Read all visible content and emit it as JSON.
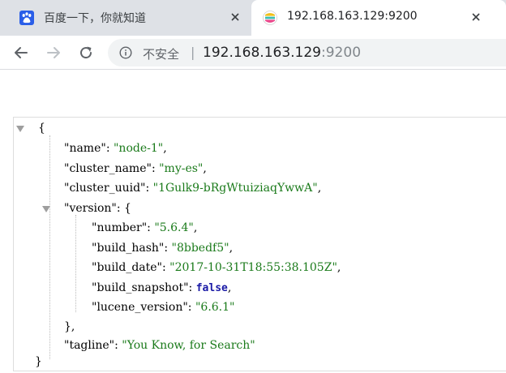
{
  "browser": {
    "tabs": [
      {
        "title": "百度一下，你就知道",
        "favicon": "baidu-paw-icon",
        "active": false
      },
      {
        "title": "192.168.163.129:9200",
        "favicon": "elastic-icon",
        "active": true
      }
    ],
    "toolbar": {
      "security_label": "不安全",
      "separator": "|",
      "url_host": "192.168.163.129",
      "url_port": ":9200"
    }
  },
  "json_viewer": {
    "open_brace": "{",
    "close_brace": "}",
    "fields": [
      {
        "key": "\"name\"",
        "sep": ": ",
        "value": "\"node-1\"",
        "tail": ","
      },
      {
        "key": "\"cluster_name\"",
        "sep": ": ",
        "value": "\"my-es\"",
        "tail": ","
      },
      {
        "key": "\"cluster_uuid\"",
        "sep": ": ",
        "value": "\"1Gulk9-bRgWtuiziaqYwwA\"",
        "tail": ","
      }
    ],
    "version": {
      "key": "\"version\"",
      "open": ": {",
      "close": "},",
      "fields": [
        {
          "key": "\"number\"",
          "sep": ": ",
          "value": "\"5.6.4\"",
          "tail": ","
        },
        {
          "key": "\"build_hash\"",
          "sep": ": ",
          "value": "\"8bbedf5\"",
          "tail": ","
        },
        {
          "key": "\"build_date\"",
          "sep": ": ",
          "value": "\"2017-10-31T18:55:38.105Z\"",
          "tail": ","
        },
        {
          "key": "\"build_snapshot\"",
          "sep": ": ",
          "value": "false",
          "tail": ","
        },
        {
          "key": "\"lucene_version\"",
          "sep": ": ",
          "value": "\"6.6.1\"",
          "tail": ""
        }
      ]
    },
    "tagline": {
      "key": "\"tagline\"",
      "sep": ": ",
      "value": "\"You Know, for Search\"",
      "tail": ""
    }
  }
}
